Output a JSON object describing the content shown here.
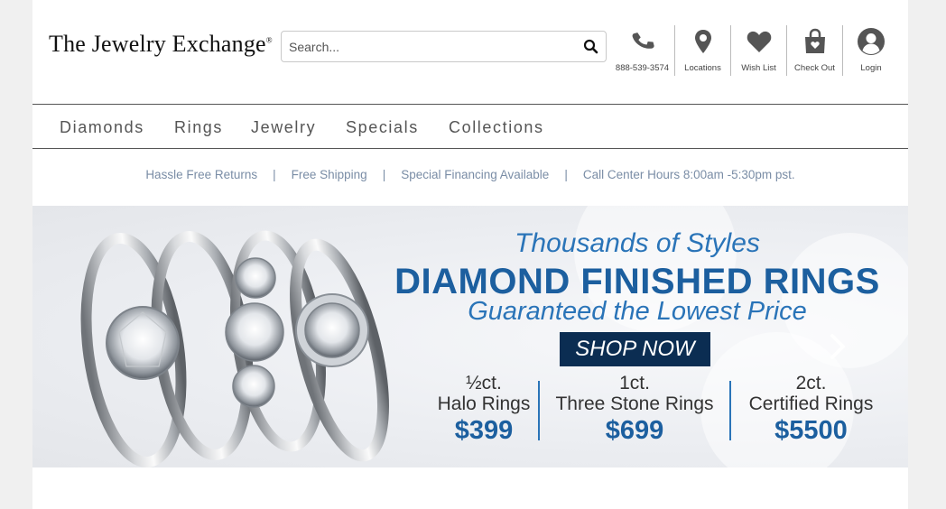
{
  "header": {
    "logo_text": "The Jewelry Exchange",
    "logo_mark": "®",
    "search_placeholder": "Search...",
    "utilities": [
      {
        "label": "888-539-3574",
        "icon": "phone-icon"
      },
      {
        "label": "Locations",
        "icon": "map-pin-icon"
      },
      {
        "label": "Wish List",
        "icon": "heart-icon"
      },
      {
        "label": "Check Out",
        "icon": "shopping-bag-icon"
      },
      {
        "label": "Login",
        "icon": "user-icon"
      }
    ]
  },
  "nav": {
    "items": [
      "Diamonds",
      "Rings",
      "Jewelry",
      "Specials",
      "Collections"
    ]
  },
  "infobar": {
    "items": [
      "Hassle Free Returns",
      "Free Shipping",
      "Special Financing Available",
      "Call Center Hours 8:00am -5:30pm pst."
    ],
    "separator": "|"
  },
  "banner": {
    "line1": "Thousands of Styles",
    "line2": "DIAMOND FINISHED RINGS",
    "line3": "Guaranteed the Lowest Price",
    "cta": "SHOP NOW",
    "deals": [
      {
        "size": "½ct.",
        "name": "Halo Rings",
        "price": "$399"
      },
      {
        "size": "1ct.",
        "name": "Three Stone Rings",
        "price": "$699"
      },
      {
        "size": "2ct.",
        "name": "Certified Rings",
        "price": "$5500"
      }
    ]
  },
  "colors": {
    "brand_blue": "#1c5f9f",
    "light_blue": "#2a74b8",
    "cta_navy": "#0b2d52",
    "icon_gray": "#555555"
  }
}
